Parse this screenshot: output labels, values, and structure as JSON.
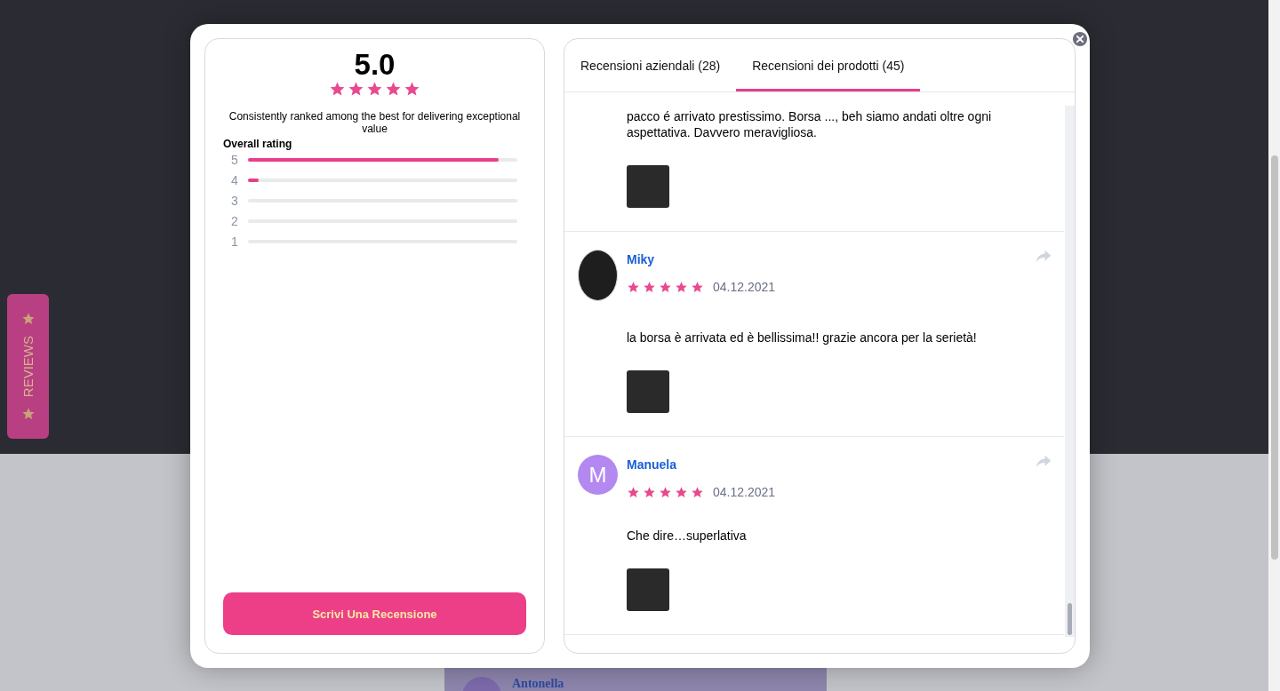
{
  "background": {
    "card_name": "Antonella"
  },
  "reviews_tab": {
    "label": "REVIEWS"
  },
  "summary": {
    "score": "5.0",
    "stars": 5,
    "tagline": "Consistently ranked among the best for delivering exceptional value",
    "overall_label": "Overall rating",
    "breakdown": [
      {
        "label": "5",
        "level": 0.93
      },
      {
        "label": "4",
        "level": 0.04
      },
      {
        "label": "3"
      },
      {
        "label": "2"
      },
      {
        "label": "1"
      }
    ],
    "button": "Scrivi Una Recensione"
  },
  "tabs": [
    {
      "label": "Recensioni aziendali (28)",
      "selected": false
    },
    {
      "label": "Recensioni dei prodotti (45)",
      "selected": true
    }
  ],
  "reviews": [
    {
      "kind": "continued",
      "text": "pacco é arrivato prestissimo. Borsa ..., beh siamo andati oltre ogni aspettativa. Davvero meravigliosa."
    },
    {
      "kind": "full",
      "name": "Miky",
      "avatar": {
        "kind": "photo"
      },
      "stars": 5,
      "date": "04.12.2021",
      "text": "la borsa è arrivata ed è bellissima!! grazie ancora per la serietà!"
    },
    {
      "kind": "full",
      "name": "Manuela",
      "avatar": {
        "kind": "initial",
        "letter": "M"
      },
      "stars": 5,
      "date": "04.12.2021",
      "text": "Che dire…superlativa"
    }
  ]
}
